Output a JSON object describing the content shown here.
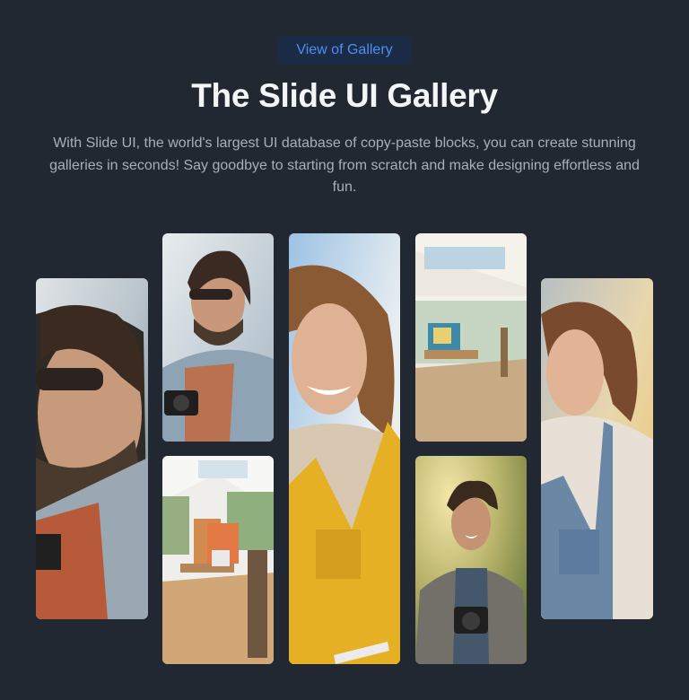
{
  "header": {
    "badge_label": "View of Gallery",
    "title": "The Slide UI Gallery",
    "description": "With Slide UI, the world's largest UI database of copy-paste blocks, you can create stunning galleries in seconds! Say goodbye to starting from scratch and make designing effortless and fun."
  },
  "gallery": {
    "photos": [
      {
        "subject": "man-sunglasses-closeup"
      },
      {
        "subject": "man-sunglasses-camera"
      },
      {
        "subject": "art-studio"
      },
      {
        "subject": "woman-yellow-overalls"
      },
      {
        "subject": "sunlit-studio-room"
      },
      {
        "subject": "man-camera-outdoors"
      },
      {
        "subject": "woman-denim-overalls"
      }
    ]
  },
  "colors": {
    "background": "#212832",
    "badge_bg": "#1b2a45",
    "badge_text": "#4f8ef2",
    "title": "#f4f5f7",
    "description": "#a9afb9"
  }
}
